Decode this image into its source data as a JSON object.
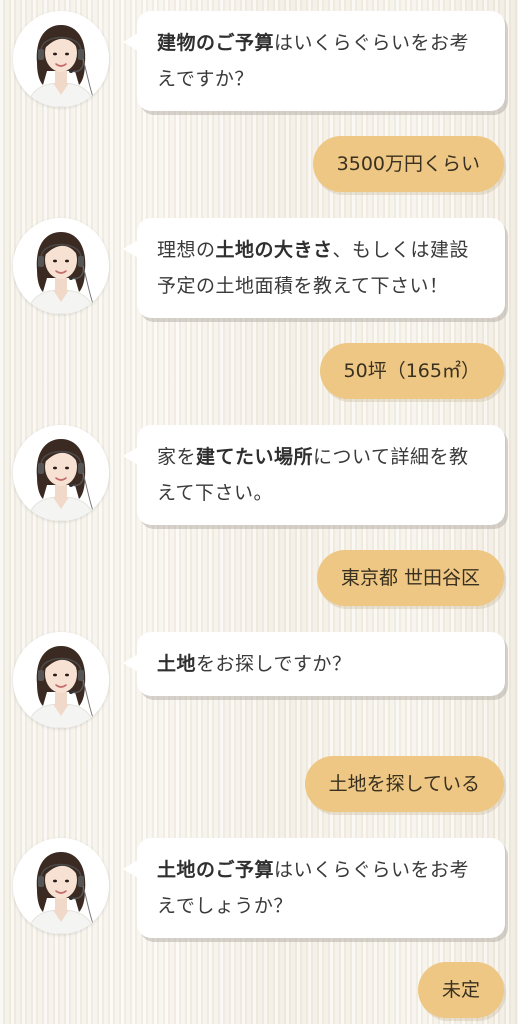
{
  "conversation": [
    {
      "role": "agent",
      "segments": [
        {
          "text": "建物のご予算",
          "bold": true
        },
        {
          "text": "はいくらぐらいをお考えですか？",
          "bold": false
        }
      ]
    },
    {
      "role": "user",
      "text": "3500万円くらい"
    },
    {
      "role": "agent",
      "segments": [
        {
          "text": "理想の",
          "bold": false
        },
        {
          "text": "土地の大きさ",
          "bold": true
        },
        {
          "text": "、もしくは建設予定の土地面積を教えて下さい！",
          "bold": false
        }
      ]
    },
    {
      "role": "user",
      "text": "50坪（165㎡）"
    },
    {
      "role": "agent",
      "segments": [
        {
          "text": "家を",
          "bold": false
        },
        {
          "text": "建てたい場所",
          "bold": true
        },
        {
          "text": "について詳細を教えて下さい。",
          "bold": false
        }
      ]
    },
    {
      "role": "user",
      "text": "東京都 世田谷区"
    },
    {
      "role": "agent",
      "segments": [
        {
          "text": "土地",
          "bold": true
        },
        {
          "text": "をお探しですか？",
          "bold": false
        }
      ]
    },
    {
      "role": "user",
      "text": "土地を探している"
    },
    {
      "role": "agent",
      "segments": [
        {
          "text": "土地のご予算",
          "bold": true
        },
        {
          "text": "はいくらぐらいをお考えでしょうか？",
          "bold": false
        }
      ]
    },
    {
      "role": "user",
      "text": "未定"
    }
  ],
  "avatar_icon": "operator-avatar-icon",
  "colors": {
    "reply_bubble": "#edc783",
    "agent_bubble": "#ffffff",
    "background": "#f4f0e8"
  }
}
